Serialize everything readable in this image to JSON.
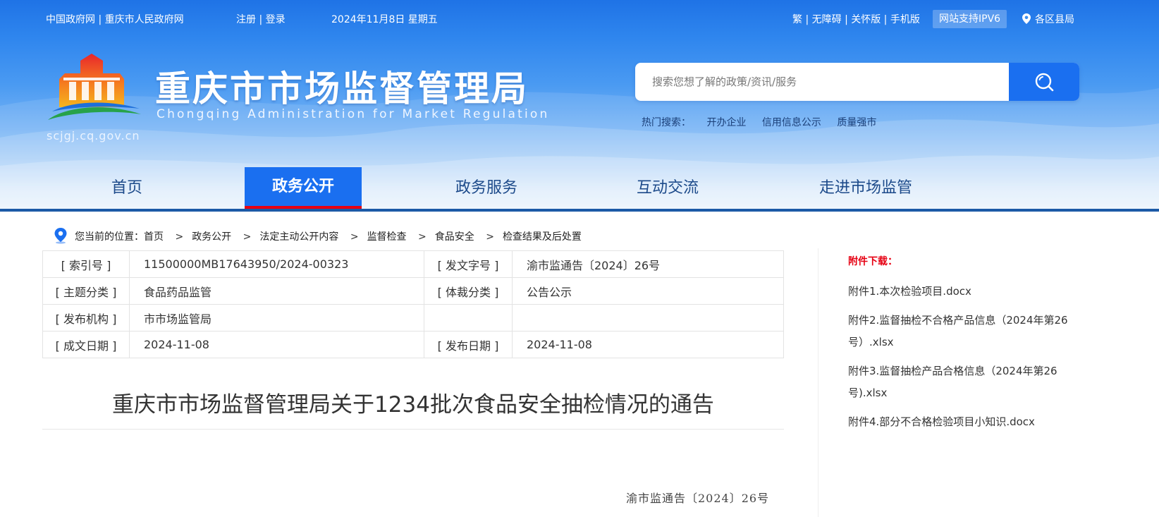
{
  "topbar": {
    "gov_links": "中国政府网 | 重庆市人民政府网",
    "account_links": "注册 | 登录",
    "date": "2024年11月8日 星期五",
    "tools": "繁 | 无障碍 | 关怀版 | 手机版",
    "ipv6": "网站支持IPV6",
    "region": "各区县局"
  },
  "brand": {
    "title_cn": "重庆市市场监督管理局",
    "title_en": "Chongqing  Administration for Market Regulation",
    "domain": "scjgj.cq.gov.cn"
  },
  "search": {
    "placeholder": "搜索您想了解的政策/资讯/服务",
    "value": ""
  },
  "hot_search": {
    "label": "热门搜索：",
    "items": [
      "开办企业",
      "信用信息公示",
      "质量强市"
    ]
  },
  "nav": {
    "items": [
      {
        "label": "首页"
      },
      {
        "label": "政务公开",
        "active": true
      },
      {
        "label": "政务服务"
      },
      {
        "label": "互动交流"
      },
      {
        "label": "走进市场监管"
      }
    ]
  },
  "breadcrumb": {
    "prefix": "您当前的位置：首页",
    "items": [
      "政务公开",
      "法定主动公开内容",
      "监督检查",
      "食品安全",
      "检查结果及后处置"
    ]
  },
  "meta": {
    "rows": [
      {
        "l1": "[ 索引号 ]",
        "v1": "11500000MB17643950/2024-00323",
        "l2": "[ 发文字号 ]",
        "v2": "渝市监通告〔2024〕26号"
      },
      {
        "l1": "[ 主题分类 ]",
        "v1": "食品药品监管",
        "l2": "[ 体裁分类 ]",
        "v2": "公告公示"
      },
      {
        "l1": "[ 发布机构 ]",
        "v1": "市市场监管局",
        "l2": "",
        "v2": ""
      },
      {
        "l1": "[ 成文日期 ]",
        "v1": "2024-11-08",
        "l2": "[ 发布日期 ]",
        "v2": "2024-11-08"
      }
    ]
  },
  "doc": {
    "title": "重庆市市场监督管理局关于1234批次食品安全抽检情况的通告",
    "number": "渝市监通告〔2024〕26号"
  },
  "sidebar": {
    "heading": "附件下载：",
    "attachments": [
      "附件1.本次检验项目.docx",
      "附件2.监督抽检不合格产品信息（2024年第26号）.xlsx",
      "附件3.监督抽检产品合格信息（2024年第26号).xlsx",
      "附件4.部分不合格检验项目小知识.docx"
    ]
  },
  "colors": {
    "brand_blue": "#1a6ff0",
    "nav_underline": "#e60012",
    "attachment_heading": "#e60012"
  }
}
